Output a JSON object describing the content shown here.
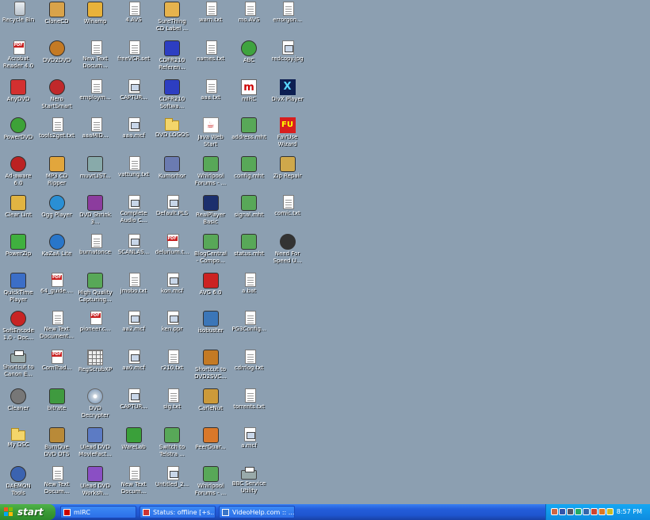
{
  "desktop": {
    "icons": [
      {
        "label": "Recycle Bin",
        "icon": "recycle-bin-icon",
        "glyph": "bin"
      },
      {
        "label": "CloneCD",
        "icon": "clonecd-icon",
        "glyph": "app",
        "color": "#d9a34a"
      },
      {
        "label": "Winamp",
        "icon": "winamp-icon",
        "glyph": "app",
        "color": "#e8b23a"
      },
      {
        "label": "4.AVS",
        "icon": "avs-file-icon",
        "glyph": "doc"
      },
      {
        "label": "SureThing\nCD Label ...",
        "icon": "surething-icon",
        "glyph": "app",
        "color": "#e6b34d"
      },
      {
        "label": "warn.txt",
        "icon": "text-file-icon",
        "glyph": "doc"
      },
      {
        "label": "mo.AVS",
        "icon": "avs-file-icon",
        "glyph": "doc"
      },
      {
        "label": "errorgon...",
        "icon": "text-file-icon",
        "glyph": "doc"
      },
      {
        "label": "Acrobat\nReader 4.0",
        "icon": "acrobat-icon",
        "glyph": "pdf"
      },
      {
        "label": "DVD2DVD",
        "icon": "dvd2dvd-icon",
        "glyph": "round",
        "color": "#c47a24"
      },
      {
        "label": "New Text\nDocum...",
        "icon": "text-file-icon",
        "glyph": "doc"
      },
      {
        "label": "freeVCR.set",
        "icon": "text-file-icon",
        "glyph": "doc"
      },
      {
        "label": "CDFR210\nReferen...",
        "icon": "book-icon",
        "glyph": "app",
        "color": "#2d3ec2"
      },
      {
        "label": "names.txt",
        "icon": "text-file-icon",
        "glyph": "doc"
      },
      {
        "label": "ABC",
        "icon": "abc-icon",
        "glyph": "round",
        "color": "#3fa33f"
      },
      {
        "label": "redcopy.jpg",
        "icon": "image-file-icon",
        "glyph": "mmc"
      },
      {
        "label": "AnyDVD",
        "icon": "anydvd-icon",
        "glyph": "app",
        "color": "#d33030"
      },
      {
        "label": "Nero\nStartSmart",
        "icon": "nero-icon",
        "glyph": "round",
        "color": "#c0282a"
      },
      {
        "label": "employm...",
        "icon": "text-file-icon",
        "glyph": "doc"
      },
      {
        "label": "CAPTUR...",
        "icon": "mmc-file-icon",
        "glyph": "mmc"
      },
      {
        "label": "CDFR210\nSoftwa...",
        "icon": "book-icon",
        "glyph": "app",
        "color": "#2d3ec2"
      },
      {
        "label": "aaa.txt",
        "icon": "text-file-icon",
        "glyph": "doc"
      },
      {
        "label": "mIRC",
        "icon": "mirc-icon",
        "glyph": "m"
      },
      {
        "label": "DivX Player",
        "icon": "divx-icon",
        "glyph": "x"
      },
      {
        "label": "PowerDVD",
        "icon": "powerdvd-icon",
        "glyph": "round",
        "color": "#3da238"
      },
      {
        "label": "tools2get.txt",
        "icon": "text-file-icon",
        "glyph": "doc"
      },
      {
        "label": "aaaMID...",
        "icon": "text-file-icon",
        "glyph": "doc"
      },
      {
        "label": "aaa.mcf",
        "icon": "mmc-file-icon",
        "glyph": "mmc"
      },
      {
        "label": "DVD LOGOS",
        "icon": "folder-icon",
        "glyph": "folder"
      },
      {
        "label": "Java Web\nStart",
        "icon": "java-icon",
        "glyph": "java"
      },
      {
        "label": "address.mht",
        "icon": "mht-file-icon",
        "glyph": "app",
        "color": "#58a858"
      },
      {
        "label": "FairUse\nWizard",
        "icon": "fairuse-icon",
        "glyph": "fu"
      },
      {
        "label": "Ad-aware\n6.0",
        "icon": "adaware-icon",
        "glyph": "round",
        "color": "#b22"
      },
      {
        "label": "MP3 CD\nRipper",
        "icon": "mp3cd-icon",
        "glyph": "app",
        "color": "#e2a63c"
      },
      {
        "label": "muvrLIST...",
        "icon": "list-icon",
        "glyph": "app",
        "color": "#8aa"
      },
      {
        "label": "vattung.txt",
        "icon": "text-file-icon",
        "glyph": "doc"
      },
      {
        "label": "Kumorhor",
        "icon": "kumorhor-icon",
        "glyph": "app",
        "color": "#6b7bb1"
      },
      {
        "label": "Whirlpool\nForums - ...",
        "icon": "web-shortcut-icon",
        "glyph": "app",
        "color": "#58a858"
      },
      {
        "label": "config.mht",
        "icon": "mht-file-icon",
        "glyph": "app",
        "color": "#58a858"
      },
      {
        "label": "Zip Repair",
        "icon": "zip-repair-icon",
        "glyph": "app",
        "color": "#cfa84b"
      },
      {
        "label": "Clear Lint",
        "icon": "clear-lint-icon",
        "glyph": "app",
        "color": "#e1b442"
      },
      {
        "label": "Ogg Player",
        "icon": "ogg-player-icon",
        "glyph": "round",
        "color": "#2a8fd4"
      },
      {
        "label": "DVD Shrink\n3...",
        "icon": "dvd-shrink-icon",
        "glyph": "app",
        "color": "#8c3c9e"
      },
      {
        "label": "Complete\nAudio C...",
        "icon": "mmc-file-icon",
        "glyph": "mmc"
      },
      {
        "label": "Default.PLS",
        "icon": "pls-file-icon",
        "glyph": "mmc"
      },
      {
        "label": "RealPlayer\nBasic",
        "icon": "realplayer-icon",
        "glyph": "app",
        "color": "#1b2f6d"
      },
      {
        "label": "signal.mht",
        "icon": "mht-file-icon",
        "glyph": "app",
        "color": "#58a858"
      },
      {
        "label": "comic.txt",
        "icon": "text-file-icon",
        "glyph": "doc"
      },
      {
        "label": "PowerZip",
        "icon": "powerzip-icon",
        "glyph": "app",
        "color": "#3fb03f"
      },
      {
        "label": "KaZaA Lite",
        "icon": "kazaa-icon",
        "glyph": "round",
        "color": "#2976c9"
      },
      {
        "label": "burnatonce",
        "icon": "text-file-icon",
        "glyph": "doc"
      },
      {
        "label": "SCANLAS...",
        "icon": "image-file-icon",
        "glyph": "mmc"
      },
      {
        "label": "delurium.t...",
        "icon": "pdf-file-icon",
        "glyph": "pdf"
      },
      {
        "label": "BlogCentral\n- Compo...",
        "icon": "web-shortcut-icon",
        "glyph": "app",
        "color": "#58a858"
      },
      {
        "label": "status.mht",
        "icon": "mht-file-icon",
        "glyph": "app",
        "color": "#58a858"
      },
      {
        "label": "Need For\nSpeed U...",
        "icon": "need-for-speed-icon",
        "glyph": "round",
        "color": "#333"
      },
      {
        "label": "QuickTime\nPlayer",
        "icon": "quicktime-icon",
        "glyph": "app",
        "color": "#3b6ec7"
      },
      {
        "label": "64_guide....",
        "icon": "pdf-file-icon",
        "glyph": "pdf"
      },
      {
        "label": "High Quality\nCapturing...",
        "icon": "web-shortcut-icon",
        "glyph": "app",
        "color": "#58a858"
      },
      {
        "label": "jmobo.txt",
        "icon": "text-file-icon",
        "glyph": "doc"
      },
      {
        "label": "kon.mcf",
        "icon": "mmc-file-icon",
        "glyph": "mmc"
      },
      {
        "label": "AVG 6.0",
        "icon": "avg-icon",
        "glyph": "app",
        "color": "#c22"
      },
      {
        "label": "a.bat",
        "icon": "batch-file-icon",
        "glyph": "doc"
      },
      {
        "label": "",
        "icon": "",
        "glyph": "none"
      },
      {
        "label": "SoftEncode\n1.0 - Doc...",
        "icon": "softencode-icon",
        "glyph": "round",
        "color": "#c82424"
      },
      {
        "label": "New Text\nDocument...",
        "icon": "text-file-icon",
        "glyph": "doc"
      },
      {
        "label": "pioneer.c...",
        "icon": "pdf-file-icon",
        "glyph": "pdf"
      },
      {
        "label": "aa2.mcf",
        "icon": "mmc-file-icon",
        "glyph": "mmc"
      },
      {
        "label": "ken.ppr",
        "icon": "mmc-file-icon",
        "glyph": "mmc"
      },
      {
        "label": "isobuster",
        "icon": "isobuster-icon",
        "glyph": "app",
        "color": "#3b76b8"
      },
      {
        "label": "PG3Config...",
        "icon": "text-file-icon",
        "glyph": "doc"
      },
      {
        "label": "",
        "icon": "",
        "glyph": "none"
      },
      {
        "label": "Shortcut to\nCanon E...",
        "icon": "printer-icon",
        "glyph": "printer"
      },
      {
        "label": "ComTrad...",
        "icon": "pdf-file-icon",
        "glyph": "pdf"
      },
      {
        "label": "RegScrubXP",
        "icon": "regscrub-icon",
        "glyph": "grid"
      },
      {
        "label": "aa0.mcf",
        "icon": "mmc-file-icon",
        "glyph": "mmc"
      },
      {
        "label": "r210.txt",
        "icon": "text-file-icon",
        "glyph": "doc"
      },
      {
        "label": "Shortcut to\nDVD2SVC...",
        "icon": "shortcut-icon",
        "glyph": "app",
        "color": "#c47a24"
      },
      {
        "label": "cdrrlog.txt",
        "icon": "text-file-icon",
        "glyph": "doc"
      },
      {
        "label": "",
        "icon": "",
        "glyph": "none"
      },
      {
        "label": "Cleaner",
        "icon": "cleaner-icon",
        "glyph": "round",
        "color": "#777"
      },
      {
        "label": "bitrate",
        "icon": "bitrate-chart-icon",
        "glyph": "app",
        "color": "#3f9a3f"
      },
      {
        "label": "DVD\nDecrypter",
        "icon": "dvd-decrypter-icon",
        "glyph": "cd"
      },
      {
        "label": "CAPTUR...",
        "icon": "mmc-file-icon",
        "glyph": "mmc"
      },
      {
        "label": "sig.txt",
        "icon": "text-file-icon",
        "glyph": "doc"
      },
      {
        "label": "CarleNut",
        "icon": "carlenut-icon",
        "glyph": "app",
        "color": "#cc9a3a"
      },
      {
        "label": "torrents.txt",
        "icon": "text-file-icon",
        "glyph": "doc"
      },
      {
        "label": "",
        "icon": "",
        "glyph": "none"
      },
      {
        "label": "My DSC",
        "icon": "folder-icon",
        "glyph": "folder"
      },
      {
        "label": "BurnQue\nDVD DTS",
        "icon": "burnque-icon",
        "glyph": "app",
        "color": "#b98a38"
      },
      {
        "label": "Ulead DVD\nMovieFact...",
        "icon": "ulead-icon",
        "glyph": "app",
        "color": "#5c7bc4"
      },
      {
        "label": "WareLab",
        "icon": "warelab-icon",
        "glyph": "app",
        "color": "#3aa03a"
      },
      {
        "label": "Switch to\nTelstra ...",
        "icon": "switch-icon",
        "glyph": "app",
        "color": "#58a858"
      },
      {
        "label": "PeerGuar...",
        "icon": "peerguardian-icon",
        "glyph": "app",
        "color": "#d9782a"
      },
      {
        "label": "a.mcf",
        "icon": "mmc-file-icon",
        "glyph": "mmc"
      },
      {
        "label": "",
        "icon": "",
        "glyph": "none"
      },
      {
        "label": "DAEMON\nTools",
        "icon": "daemon-tools-icon",
        "glyph": "round",
        "color": "#3b63b0"
      },
      {
        "label": "New Text\nDocum...",
        "icon": "text-file-icon",
        "glyph": "doc"
      },
      {
        "label": "Ulead DVD\nWorksh...",
        "icon": "ulead-icon",
        "glyph": "app",
        "color": "#8a4fc4"
      },
      {
        "label": "New Text\nDocum...",
        "icon": "text-file-icon",
        "glyph": "doc"
      },
      {
        "label": "Untitled_2...",
        "icon": "mmc-file-icon",
        "glyph": "mmc"
      },
      {
        "label": "Whirlpool\nForums - ...",
        "icon": "web-shortcut-icon",
        "glyph": "app",
        "color": "#58a858"
      },
      {
        "label": "BBC Service\nUtility",
        "icon": "printer-icon",
        "glyph": "printer"
      },
      {
        "label": "",
        "icon": "",
        "glyph": "none"
      }
    ]
  },
  "taskbar": {
    "start_label": "start",
    "tasks": [
      {
        "label": "mIRC",
        "icon": "mirc-icon",
        "color": "#c00"
      },
      {
        "label": "Status: offline [+s...",
        "icon": "status-icon",
        "color": "#c33"
      },
      {
        "label": "VideoHelp.com :: ...",
        "icon": "browser-icon",
        "color": "#3b76c8"
      }
    ],
    "tray_icons": [
      {
        "icon": "network-icon",
        "color": "#c64"
      },
      {
        "icon": "antivirus-icon",
        "color": "#35a"
      },
      {
        "icon": "volume-icon",
        "color": "#556"
      },
      {
        "icon": "shield-icon",
        "color": "#2a6"
      },
      {
        "icon": "daemon-tray-icon",
        "color": "#36a"
      },
      {
        "icon": "java-tray-icon",
        "color": "#c43"
      },
      {
        "icon": "peerguardian-tray-icon",
        "color": "#d72"
      },
      {
        "icon": "warning-icon",
        "color": "#cb2"
      }
    ],
    "clock": "8:57 PM"
  }
}
